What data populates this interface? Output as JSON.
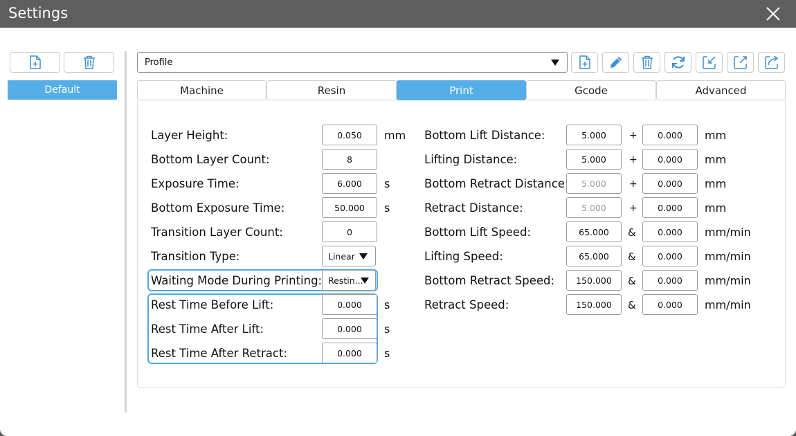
{
  "window": {
    "title": "Settings"
  },
  "sidebar": {
    "profiles": [
      {
        "label": "Default"
      }
    ]
  },
  "profile_select": {
    "value": "Profile"
  },
  "toolbar_icons": [
    "add-file-icon",
    "edit-icon",
    "trash-icon",
    "refresh-icon",
    "import-icon",
    "export-icon",
    "export-all-icon"
  ],
  "tabs": [
    {
      "label": "Machine"
    },
    {
      "label": "Resin"
    },
    {
      "label": "Print",
      "active": true
    },
    {
      "label": "Gcode"
    },
    {
      "label": "Advanced"
    }
  ],
  "left": {
    "layer_height": {
      "label": "Layer Height:",
      "value": "0.050",
      "unit": "mm"
    },
    "bottom_layer_count": {
      "label": "Bottom Layer Count:",
      "value": "8"
    },
    "exposure_time": {
      "label": "Exposure Time:",
      "value": "6.000",
      "unit": "s"
    },
    "bottom_exposure_time": {
      "label": "Bottom Exposure Time:",
      "value": "50.000",
      "unit": "s"
    },
    "transition_layer_count": {
      "label": "Transition Layer Count:",
      "value": "0"
    },
    "transition_type": {
      "label": "Transition Type:",
      "value": "Linear"
    },
    "waiting_mode": {
      "label": "Waiting Mode During Printing:",
      "value": "Restin..."
    },
    "rest_before_lift": {
      "label": "Rest Time Before Lift:",
      "value": "0.000",
      "unit": "s"
    },
    "rest_after_lift": {
      "label": "Rest Time After Lift:",
      "value": "0.000",
      "unit": "s"
    },
    "rest_after_retract": {
      "label": "Rest Time After Retract:",
      "value": "0.000",
      "unit": "s"
    }
  },
  "right": {
    "bottom_lift_distance": {
      "label": "Bottom Lift Distance:",
      "value": "5.000",
      "op": "+",
      "value2": "0.000",
      "unit": "mm"
    },
    "lifting_distance": {
      "label": "Lifting Distance:",
      "value": "5.000",
      "op": "+",
      "value2": "0.000",
      "unit": "mm"
    },
    "bottom_retract_distance": {
      "label": "Bottom Retract Distance:",
      "value": "5.000",
      "op": "+",
      "value2": "0.000",
      "unit": "mm"
    },
    "retract_distance": {
      "label": "Retract Distance:",
      "value": "5.000",
      "op": "+",
      "value2": "0.000",
      "unit": "mm"
    },
    "bottom_lift_speed": {
      "label": "Bottom Lift Speed:",
      "value": "65.000",
      "op": "&",
      "value2": "0.000",
      "unit": "mm/min"
    },
    "lifting_speed": {
      "label": "Lifting Speed:",
      "value": "65.000",
      "op": "&",
      "value2": "0.000",
      "unit": "mm/min"
    },
    "bottom_retract_speed": {
      "label": "Bottom Retract Speed:",
      "value": "150.000",
      "op": "&",
      "value2": "0.000",
      "unit": "mm/min"
    },
    "retract_speed": {
      "label": "Retract Speed:",
      "value": "150.000",
      "op": "&",
      "value2": "0.000",
      "unit": "mm/min"
    }
  },
  "colors": {
    "accent": "#55aee8",
    "titlebar": "#5e5e5e",
    "highlight": "#4fa8e0"
  }
}
